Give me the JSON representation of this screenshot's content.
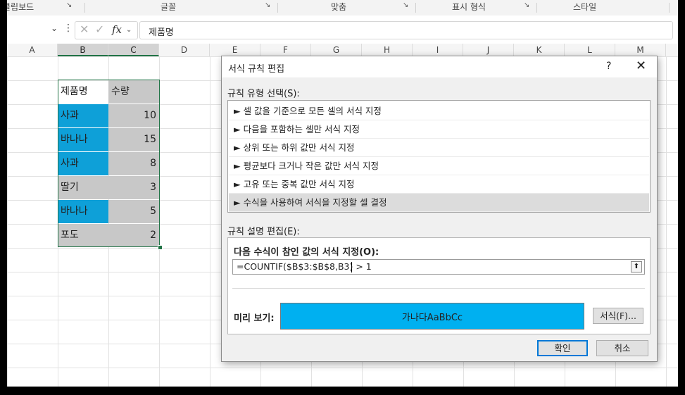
{
  "ribbon": {
    "groups": [
      "클립보드",
      "글꼴",
      "맞춤",
      "표시 형식",
      "스타일"
    ]
  },
  "formula_bar": {
    "name_box": "",
    "content": "제품명"
  },
  "columns": [
    "A",
    "B",
    "C",
    "D",
    "E",
    "F",
    "G",
    "H",
    "I",
    "J",
    "K",
    "L",
    "M"
  ],
  "table": {
    "header": [
      "제품명",
      "수량"
    ],
    "rows": [
      {
        "name": "사과",
        "qty": "10"
      },
      {
        "name": "바나나",
        "qty": "15"
      },
      {
        "name": "사과",
        "qty": "8"
      },
      {
        "name": "딸기",
        "qty": "3"
      },
      {
        "name": "바나나",
        "qty": "5"
      },
      {
        "name": "포도",
        "qty": "2"
      }
    ]
  },
  "dialog": {
    "title": "서식 규칙 편집",
    "help": "?",
    "close": "✕",
    "rule_type_label": "규칙 유형 선택(S):",
    "rule_types": [
      "► 셀 값을 기준으로 모든 셀의 서식 지정",
      "► 다음을 포함하는 셀만 서식 지정",
      "► 상위 또는 하위 값만 서식 지정",
      "► 평균보다 크거나 작은 값만 서식 지정",
      "► 고유 또는 중복 값만 서식 지정",
      "► 수식을 사용하여 서식을 지정할 셀 결정"
    ],
    "rule_desc_label": "규칙 설명 편집(E):",
    "formula_label": "다음 수식이 참인 값의 서식 지정(O):",
    "formula_value": "=COUNTIF($B$3:$B$8,B3) > 1",
    "preview_label": "미리 보기:",
    "preview_text": "가나다AaBbCc",
    "format_button": "서식(F)...",
    "ok_button": "확인",
    "cancel_button": "취소"
  },
  "colors": {
    "highlight_blue": "#0ea0d8",
    "qty_gray": "#c8c8c8",
    "preview_fill": "#00b0f0",
    "selection_green": "#217346"
  }
}
